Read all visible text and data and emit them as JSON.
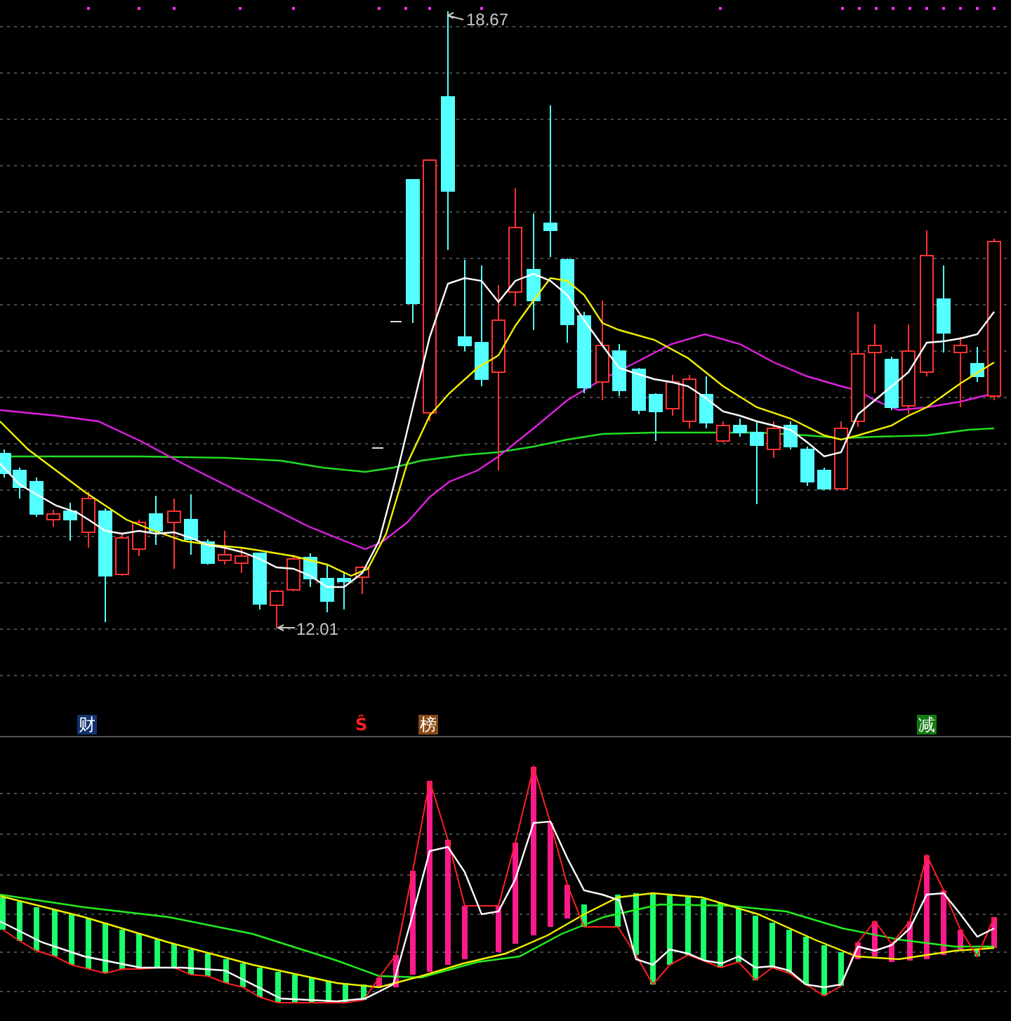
{
  "price_chart": {
    "high_label": "18.67",
    "low_label": "12.01"
  },
  "event_markers": [
    {
      "text": "财",
      "kind": "badge",
      "color": "#12326e"
    },
    {
      "text": "Ŝ",
      "kind": "plain",
      "color": "#ff2020"
    },
    {
      "text": "榜",
      "kind": "badge",
      "color": "#8a4a14"
    },
    {
      "text": "减",
      "kind": "badge",
      "color": "#137a13"
    }
  ]
}
